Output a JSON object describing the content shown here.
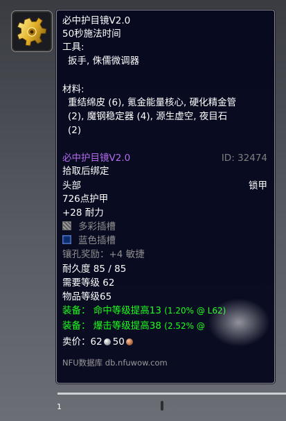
{
  "item": {
    "name": "必中护目镜V2.0",
    "cast_time": "50秒施法时间",
    "tools_label": "工具:",
    "tools": "扳手, 侏儒微调器",
    "materials_label": "材料:",
    "materials_line1": "重结绵皮 (6), 氪金能量核心, 硬化精金管",
    "materials_line2": "(2), 魔钢稳定器 (4), 源生虚空, 夜目石",
    "materials_line3": "(2)",
    "result_name": "必中护目镜V2.0",
    "item_id": "ID: 32474",
    "bind": "拾取后绑定",
    "slot": "头部",
    "armor_type": "锁甲",
    "armor": "726点护甲",
    "stamina": "+28 耐力",
    "socket_meta": "多彩插槽",
    "socket_blue": "蓝色插槽",
    "socket_bonus": "镶孔奖励：+4 敏捷",
    "durability": "耐久度 85 / 85",
    "req_level": "需要等级 62",
    "item_level": "物品等级65",
    "equip1_prefix": "装备：",
    "equip1_text": "命中等级提高13",
    "equip1_detail": "(1.20% @ L62)",
    "equip2_prefix": "装备：",
    "equip2_text": "爆击等级提高38",
    "equip2_detail": "(2.52% @",
    "sell_label": "卖价：",
    "sell_silver": "62",
    "sell_copper": "50",
    "source": "NFU数据库 db.nfuwow.com"
  },
  "scroll": {
    "label": "1"
  },
  "colors": {
    "purple_quality": "#b36cf0",
    "green_equip": "#1eff1e",
    "tooltip_bg": "#06081e"
  },
  "icons": {
    "item_icon": "gear-icon",
    "socket_meta": "meta-socket-icon",
    "socket_blue": "blue-socket-icon",
    "coin_silver": "silver-coin-icon",
    "coin_copper": "copper-coin-icon"
  }
}
